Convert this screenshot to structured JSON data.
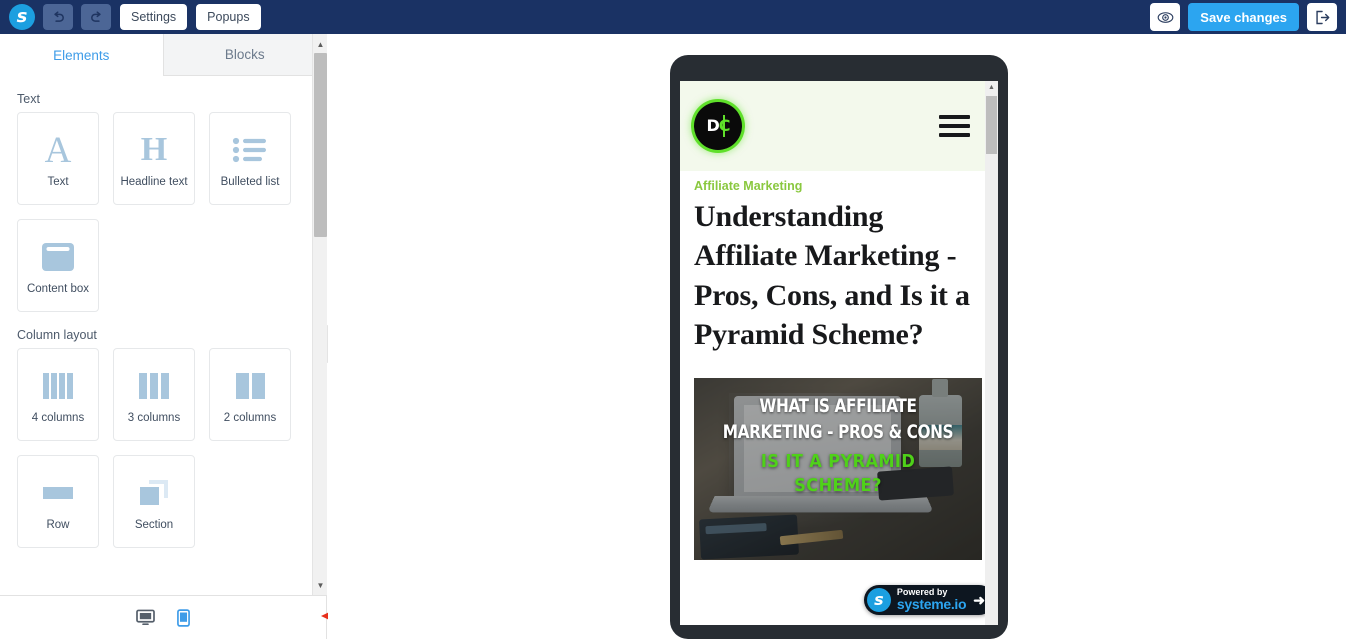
{
  "header": {
    "brand_icon": "systeme-s-logo",
    "undo_icon": "undo-arrow-icon",
    "redo_icon": "redo-arrow-icon",
    "settings_label": "Settings",
    "popups_label": "Popups",
    "preview_icon": "eye-icon",
    "save_label": "Save changes",
    "exit_icon": "exit-door-icon",
    "bg_color": "#1a3264",
    "save_color": "#2ca5f0"
  },
  "left_panel": {
    "tabs": [
      {
        "label": "Elements",
        "active": true
      },
      {
        "label": "Blocks",
        "active": false
      }
    ],
    "active_tab_color": "#3e9ce8",
    "groups": [
      {
        "title": "Text",
        "items": [
          {
            "label": "Text",
            "icon": "letter-a-icon"
          },
          {
            "label": "Headline text",
            "icon": "letter-h-icon"
          },
          {
            "label": "Bulleted list",
            "icon": "bulleted-list-icon"
          },
          {
            "label": "Content box",
            "icon": "content-box-icon"
          }
        ]
      },
      {
        "title": "Column layout",
        "items": [
          {
            "label": "4 columns",
            "icon": "four-columns-icon"
          },
          {
            "label": "3 columns",
            "icon": "three-columns-icon"
          },
          {
            "label": "2 columns",
            "icon": "two-columns-icon"
          },
          {
            "label": "Row",
            "icon": "row-icon"
          },
          {
            "label": "Section",
            "icon": "section-icon"
          }
        ]
      }
    ],
    "icon_color": "#a8c6dd"
  },
  "bottom_bar": {
    "desktop_icon": "desktop-monitor-icon",
    "mobile_icon": "mobile-phone-icon",
    "active_device": "mobile",
    "active_color": "#3e9ce8",
    "inactive_color": "#555f6b",
    "annotation_icon": "red-arrow-annotation",
    "annotation_color": "#e8301c"
  },
  "preview": {
    "device": "mobile",
    "site": {
      "header_bg": "#f3f9ec",
      "logo": {
        "icon": "dc-coin-logo",
        "letter_left": "D",
        "letter_right": "C",
        "ring_color": "#5fe02a"
      },
      "menu_icon": "hamburger-menu-icon"
    },
    "article": {
      "category": "Affiliate Marketing",
      "category_color": "#8ac83f",
      "title": "Understanding Affiliate Marketing - Pros, Cons, and Is it a Pyramid Scheme?",
      "hero_image": {
        "alt": "laptop-on-desk-photo",
        "overlay_line1": "WHAT IS AFFILIATE",
        "overlay_line2": "MARKETING - PROS & CONS",
        "overlay_line3": "IS IT A PYRAMID",
        "overlay_line4": "SCHEME?",
        "overlay_white_color": "#ffffff",
        "overlay_green_color": "#4fd119"
      }
    },
    "powered_badge": {
      "prefix": "Powered by",
      "brand": "systeme.io",
      "s_icon": "systeme-s-logo",
      "arrow_icon": "arrow-right-icon"
    }
  }
}
